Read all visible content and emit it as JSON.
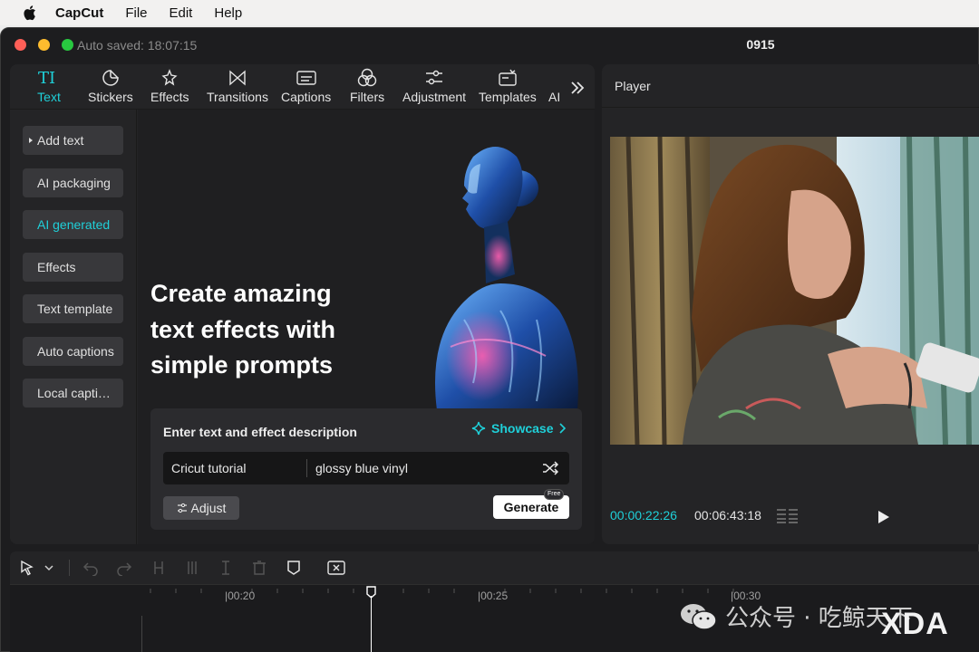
{
  "menubar": {
    "app_name": "CapCut",
    "items": [
      "File",
      "Edit",
      "Help"
    ]
  },
  "window": {
    "autosave": "Auto saved: 18:07:15",
    "project_title": "0915"
  },
  "tabs": [
    {
      "label": "Text",
      "icon": "text-icon",
      "active": true
    },
    {
      "label": "Stickers",
      "icon": "sticker-icon"
    },
    {
      "label": "Effects",
      "icon": "sparkle-icon"
    },
    {
      "label": "Transitions",
      "icon": "bowtie-icon"
    },
    {
      "label": "Captions",
      "icon": "captions-icon"
    },
    {
      "label": "Filters",
      "icon": "filters-icon"
    },
    {
      "label": "Adjustment",
      "icon": "sliders-icon"
    },
    {
      "label": "Templates",
      "icon": "templates-icon"
    },
    {
      "label": "AI",
      "icon": "ai-icon"
    }
  ],
  "subnav": [
    {
      "label": "Add text",
      "expand": true
    },
    {
      "label": "AI packaging"
    },
    {
      "label": "AI generated",
      "active": true
    },
    {
      "label": "Effects"
    },
    {
      "label": "Text template"
    },
    {
      "label": "Auto captions"
    },
    {
      "label": "Local capti…"
    }
  ],
  "hero": {
    "line1": "Create amazing",
    "line2": "text effects with",
    "line3": "simple prompts"
  },
  "generator": {
    "title": "Enter text and effect description",
    "showcase": "Showcase",
    "text_value": "Cricut tutorial",
    "effect_value": "glossy blue vinyl",
    "adjust_label": "Adjust",
    "generate_label": "Generate",
    "free_badge": "Free"
  },
  "player": {
    "title": "Player",
    "current_time": "00:00:22:26",
    "total_time": "00:06:43:18"
  },
  "timeline": {
    "ruler_labels": [
      "|00:20",
      "|00:25",
      "|00:30"
    ]
  },
  "watermark": {
    "text": "公众号 · 吃鲸天下",
    "brand": "XDA"
  },
  "colors": {
    "accent": "#1fd0d9",
    "panel": "#242426",
    "background": "#1d1d1f"
  }
}
